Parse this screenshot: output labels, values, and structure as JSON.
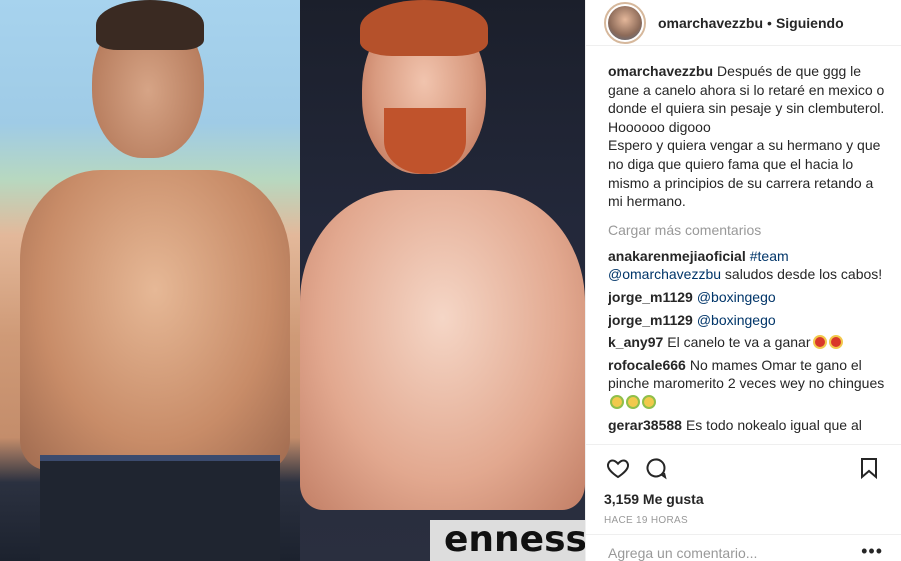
{
  "post": {
    "username": "omarchavezzbu",
    "follow_separator": "•",
    "follow_status": "Siguiendo",
    "caption_user": "omarchavezzbu",
    "caption_text_1": "Después de que ggg le gane a canelo ahora si lo retaré en mexico o donde el quiera sin pesaje y sin clembuterol. Hoooooo digooo",
    "caption_text_2": "Espero y quiera vengar a su hermano y que no diga que quiero fama que el hacia lo mismo a principios de su carrera retando a mi hermano.",
    "load_more": "Cargar más comentarios",
    "likes": "3,159 Me gusta",
    "time": "HACE 19 HORAS",
    "add_comment_placeholder": "Agrega un comentario...",
    "more_label": "•••",
    "photo_brand_text": "ennessy"
  },
  "comments": [
    {
      "user": "anakarenmejiaoficial",
      "parts": [
        {
          "t": "#team",
          "k": "tag"
        },
        {
          "t": " ",
          "k": "text"
        },
        {
          "t": "@omarchavezzbu",
          "k": "mention"
        },
        {
          "t": " saludos desde los cabos!",
          "k": "text"
        }
      ]
    },
    {
      "user": "jorge_m1129",
      "parts": [
        {
          "t": "@boxingego",
          "k": "mention"
        }
      ]
    },
    {
      "user": "jorge_m1129",
      "parts": [
        {
          "t": "@boxingego",
          "k": "mention"
        }
      ]
    },
    {
      "user": "k_any97",
      "parts": [
        {
          "t": "El canelo te va a ganar",
          "k": "text"
        }
      ],
      "emojis": [
        "tongue",
        "tongue"
      ]
    },
    {
      "user": "rofocale666",
      "parts": [
        {
          "t": "No mames Omar te gano el pinche maromerito 2 veces wey no chingues",
          "k": "text"
        }
      ],
      "emojis": [
        "sweat",
        "sweat",
        "sweat"
      ]
    },
    {
      "user": "gerar38588",
      "parts": [
        {
          "t": "Es todo nokealo igual que al",
          "k": "text"
        }
      ]
    }
  ],
  "icons": {
    "like": "heart-icon",
    "comment": "comment-icon",
    "save": "bookmark-icon",
    "more": "more-options-icon"
  }
}
